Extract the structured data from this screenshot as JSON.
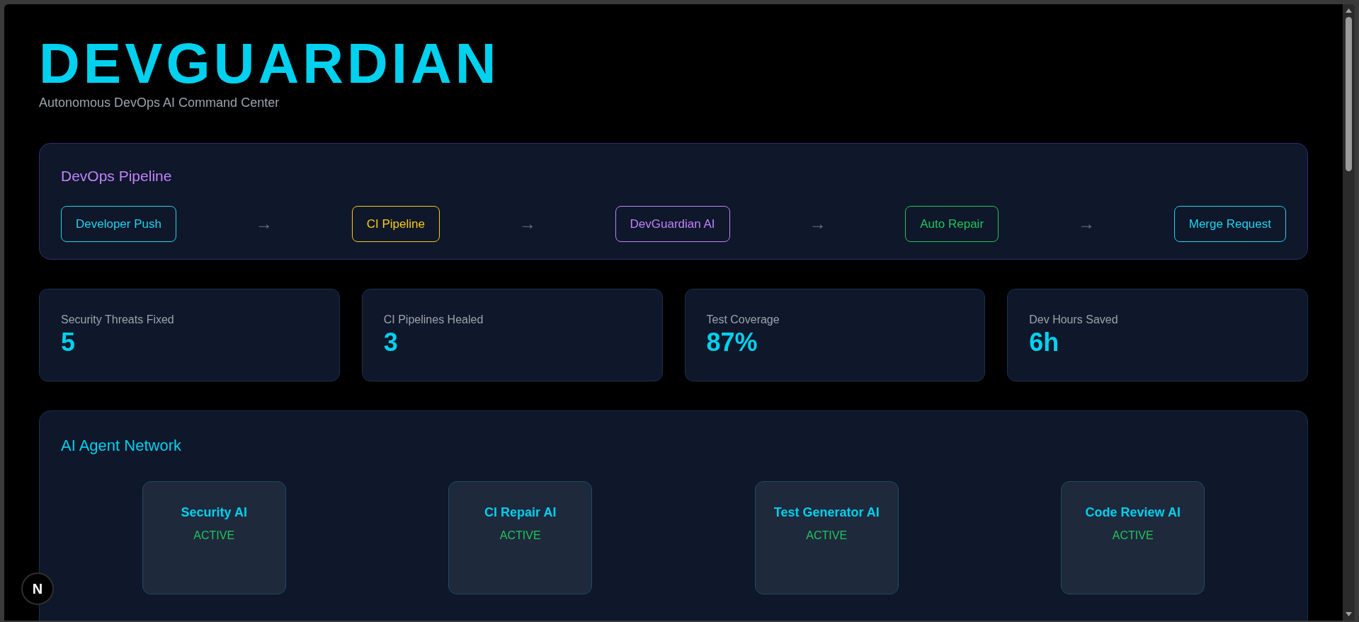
{
  "header": {
    "title": "DEVGUARDIAN",
    "subtitle": "Autonomous DevOps AI Command Center"
  },
  "pipeline": {
    "title": "DevOps Pipeline",
    "separator": "→",
    "stages": [
      {
        "label": "Developer Push",
        "color": "#22d3ee"
      },
      {
        "label": "CI Pipeline",
        "color": "#facc15"
      },
      {
        "label": "DevGuardian AI",
        "color": "#c084fc"
      },
      {
        "label": "Auto Repair",
        "color": "#22c55e"
      },
      {
        "label": "Merge Request",
        "color": "#22d3ee"
      }
    ]
  },
  "stats": [
    {
      "label": "Security Threats Fixed",
      "value": "5"
    },
    {
      "label": "CI Pipelines Healed",
      "value": "3"
    },
    {
      "label": "Test Coverage",
      "value": "87%"
    },
    {
      "label": "Dev Hours Saved",
      "value": "6h"
    }
  ],
  "agents": {
    "title": "AI Agent Network",
    "items": [
      {
        "name": "Security AI",
        "status": "ACTIVE"
      },
      {
        "name": "CI Repair AI",
        "status": "ACTIVE"
      },
      {
        "name": "Test Generator AI",
        "status": "ACTIVE"
      },
      {
        "name": "Code Review AI",
        "status": "ACTIVE"
      }
    ]
  },
  "dev_indicator": {
    "label": "N"
  }
}
